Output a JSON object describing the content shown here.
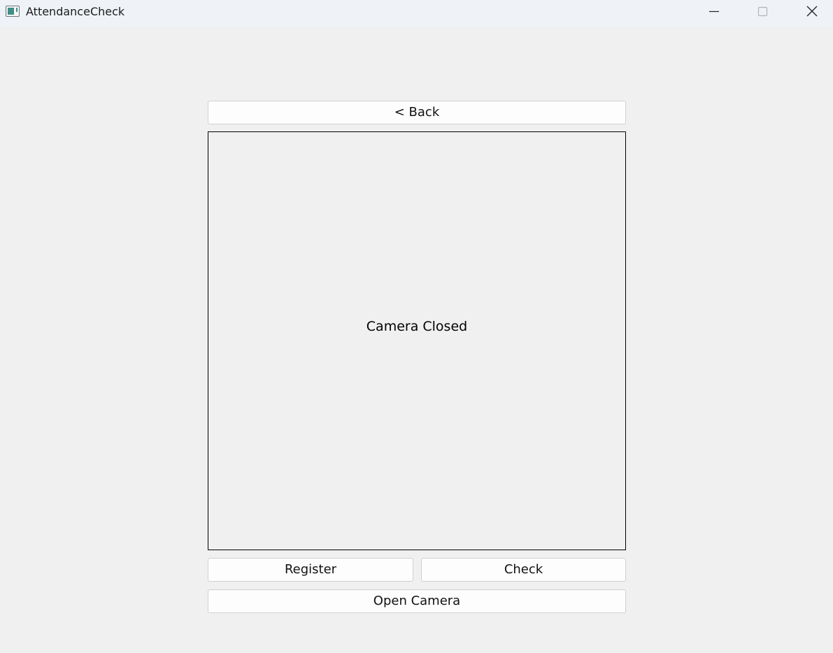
{
  "window": {
    "title": "AttendanceCheck",
    "controls": {
      "minimize_icon": "minimize-icon",
      "maximize_icon": "maximize-icon",
      "close_icon": "close-icon"
    }
  },
  "main": {
    "back_label": "< Back",
    "camera_status": "Camera Closed",
    "register_label": "Register",
    "check_label": "Check",
    "open_camera_label": "Open Camera"
  },
  "colors": {
    "titlebar_bg": "#eff3f7",
    "window_bg": "#f0f0f0",
    "button_bg": "#fdfdfd",
    "button_border": "#d0d0d0",
    "camera_border": "#000000",
    "icon_accent": "#3f8f86"
  }
}
